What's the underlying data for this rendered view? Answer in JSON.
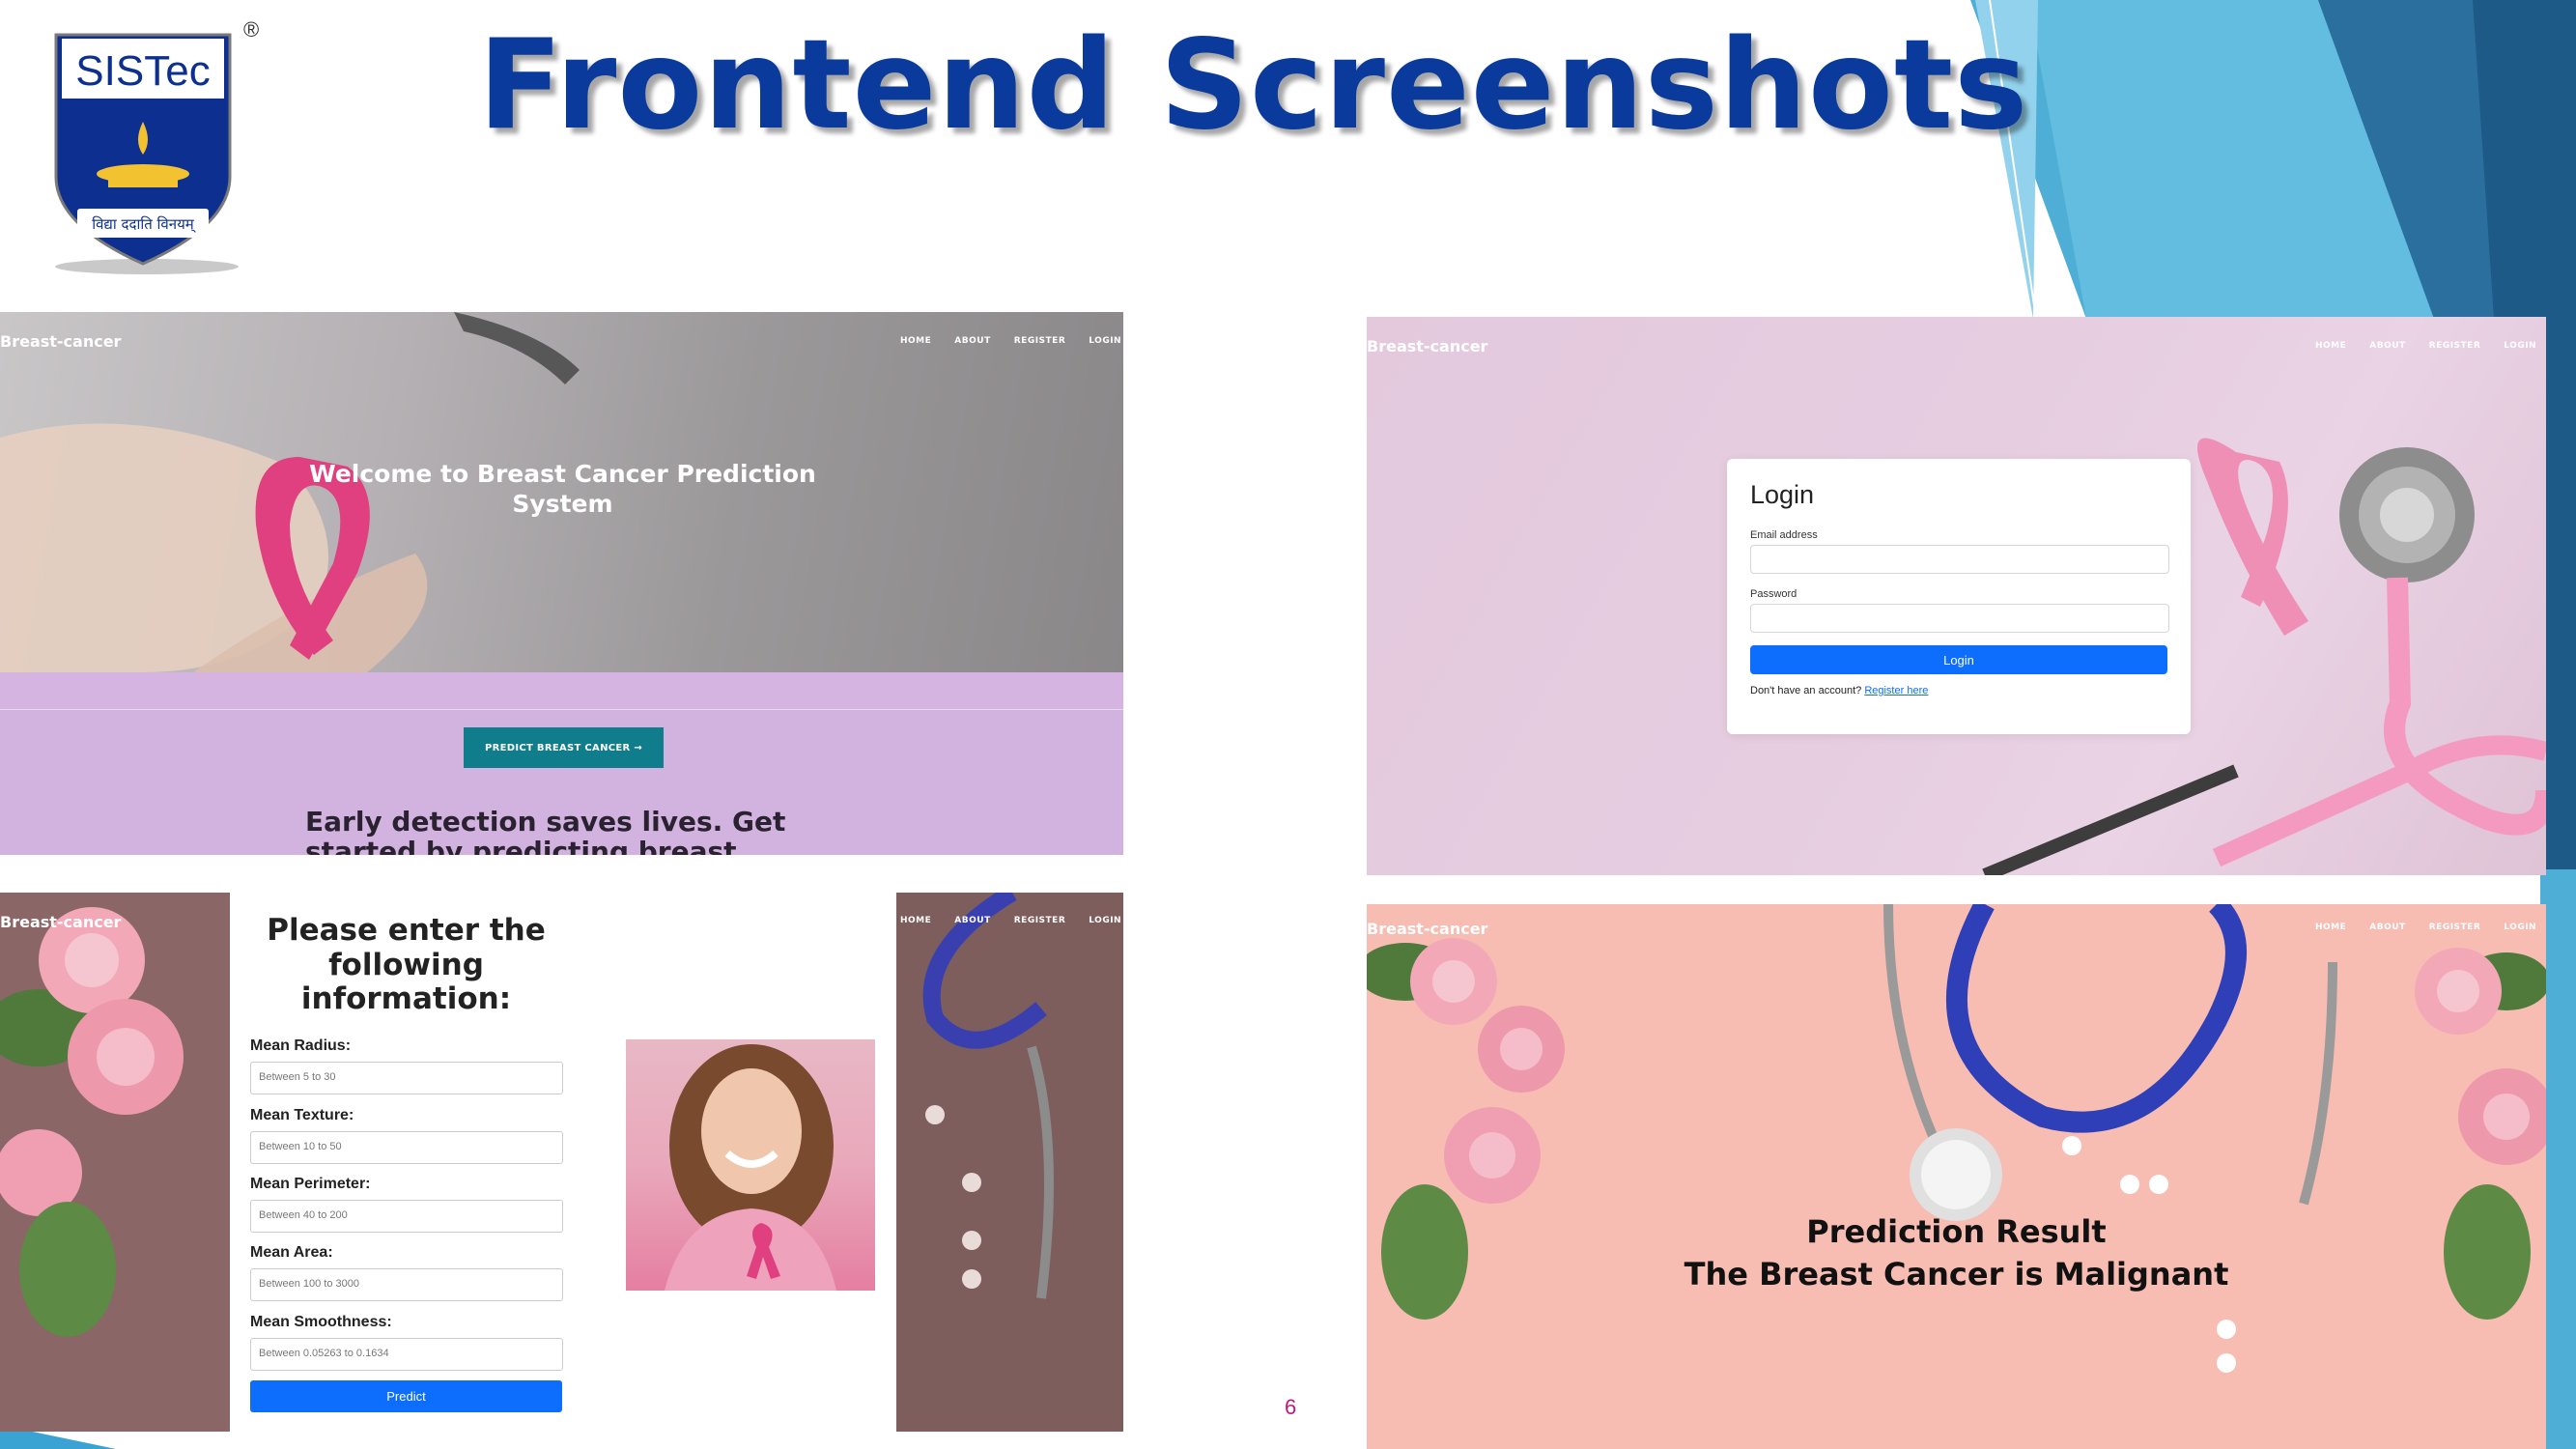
{
  "slide": {
    "title": "Frontend Screenshots",
    "page_number": "6"
  },
  "logo": {
    "name": "SISTec",
    "registered": "®",
    "motto": "विद्या ददाति विनयम्"
  },
  "nav_items": [
    "HOME",
    "ABOUT",
    "REGISTER",
    "LOGIN"
  ],
  "home_screen": {
    "brand": "Breast-cancer",
    "hero_title": "Welcome to Breast Cancer Prediction System",
    "predict_button": "PREDICT BREAST CANCER →",
    "tagline": "Early detection saves lives. Get started by predicting breast cancer"
  },
  "login_screen": {
    "brand": "Breast-cancer",
    "heading": "Login",
    "email_label": "Email address",
    "password_label": "Password",
    "submit_label": "Login",
    "register_prompt": "Don't have an account?",
    "register_link": "Register here"
  },
  "form_screen": {
    "brand": "Breast-cancer",
    "title": "Please enter the following information:",
    "fields": [
      {
        "label": "Mean Radius:",
        "placeholder": "Between 5 to 30"
      },
      {
        "label": "Mean Texture:",
        "placeholder": "Between 10 to 50"
      },
      {
        "label": "Mean Perimeter:",
        "placeholder": "Between 40 to 200"
      },
      {
        "label": "Mean Area:",
        "placeholder": "Between 100 to 3000"
      },
      {
        "label": "Mean Smoothness:",
        "placeholder": "Between 0.05263 to 0.1634"
      }
    ],
    "submit_label": "Predict"
  },
  "result_screen": {
    "brand": "Breast-cancer",
    "heading": "Prediction Result",
    "result": "The Breast Cancer is Malignant"
  }
}
